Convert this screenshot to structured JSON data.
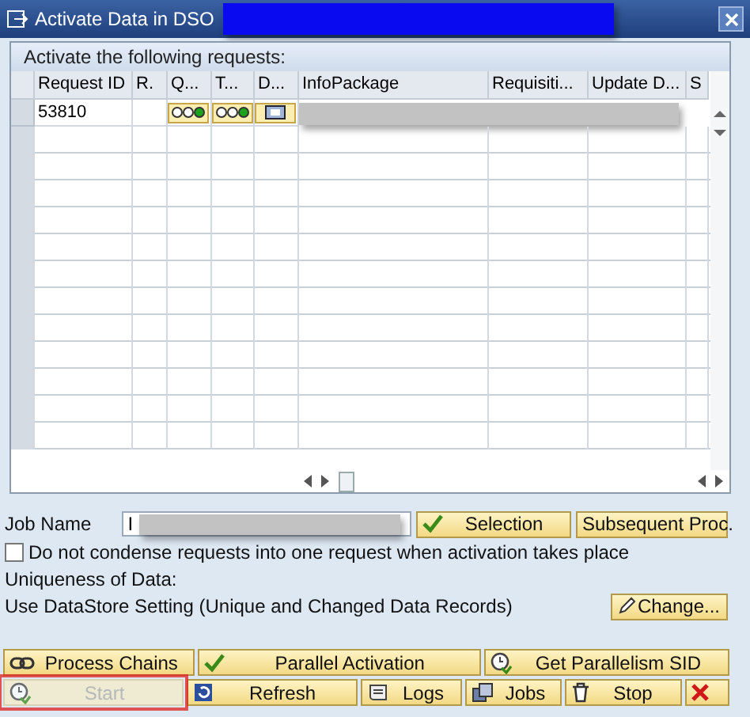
{
  "window": {
    "title": "Activate Data in DSO"
  },
  "table": {
    "title": "Activate the following requests:",
    "columns": [
      "Request ID",
      "R.",
      "Q...",
      "T...",
      "D...",
      "InfoPackage",
      "Requisiti...",
      "Update D...",
      "S"
    ],
    "rows": [
      {
        "request_id": "53810"
      }
    ]
  },
  "job_name": {
    "label": "Job Name",
    "value": "I"
  },
  "selection_buttons": [
    {
      "label": "Selection"
    },
    {
      "label": "Subsequent Proc."
    }
  ],
  "condense_option": {
    "label": "Do not condense requests into one request when activation takes place",
    "checked": false
  },
  "uniqueness": {
    "label": "Uniqueness of Data:",
    "value": "Use DataStore Setting (Unique and Changed Data Records)",
    "button": "Change..."
  },
  "action_rows": [
    [
      {
        "label": "Process Chains",
        "disabled": false,
        "highlighted": false
      },
      {
        "label": "Parallel Activation",
        "disabled": false,
        "highlighted": false
      },
      {
        "label": "Get Parallelism SID",
        "disabled": false,
        "highlighted": false
      }
    ],
    [
      {
        "label": "Start",
        "disabled": true,
        "highlighted": true
      },
      {
        "label": "Refresh",
        "disabled": false,
        "highlighted": false
      },
      {
        "label": "Logs",
        "disabled": false,
        "highlighted": false
      },
      {
        "label": "Jobs",
        "disabled": false,
        "highlighted": false
      },
      {
        "label": "Stop",
        "disabled": false,
        "highlighted": false
      },
      {
        "disabled": false,
        "highlighted": false
      }
    ]
  ]
}
